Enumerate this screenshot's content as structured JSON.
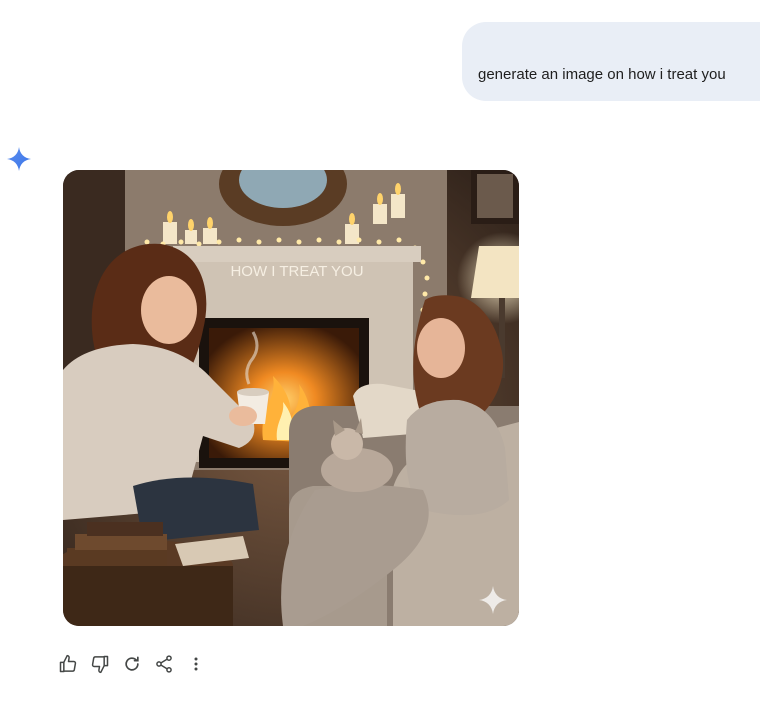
{
  "conversation": {
    "user_message": "generate an image on how i treat you",
    "response_image": {
      "banner_text": "HOW I TREAT YOU"
    }
  },
  "actions": [
    {
      "name": "thumbs-up-icon"
    },
    {
      "name": "thumbs-down-icon"
    },
    {
      "name": "regenerate-icon"
    },
    {
      "name": "share-icon"
    },
    {
      "name": "more-options-icon"
    }
  ],
  "colors": {
    "user_bubble": "#e9eef6",
    "spark_blue": "#4285f4",
    "icon": "#444746"
  }
}
